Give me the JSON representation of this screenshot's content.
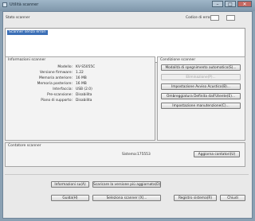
{
  "window": {
    "title": "Utilità scanner"
  },
  "header": {
    "status_label": "Stato scanner",
    "error_code_label": "Codice di errore"
  },
  "status": {
    "selected_item": "Scanner senza errori"
  },
  "info": {
    "title": "Informazioni scanner",
    "rows": [
      {
        "key": "Modello:",
        "value": "KV-S5055C"
      },
      {
        "key": "Versione firmware:",
        "value": "1.22"
      },
      {
        "key": "Memoria anteriore:",
        "value": "16 MB"
      },
      {
        "key": "Memoria posteriore:",
        "value": "16 MB"
      },
      {
        "key": "Interfaccia:",
        "value": "USB (2.0)"
      },
      {
        "key": "Pre-scansione:",
        "value": "Disabilita"
      },
      {
        "key": "Piano di supporto:",
        "value": "Disabilita"
      }
    ]
  },
  "conditions": {
    "title": "Condizione scanner",
    "buttons": [
      {
        "label": "Modalità di spegnimento automatico(S)...",
        "enabled": true
      },
      {
        "label": "Eliminazione(P)...",
        "enabled": false
      },
      {
        "label": "Impostazione Avviso Acustico(B)...",
        "enabled": true
      },
      {
        "label": "Ombreggiatura Definita dall'Utente(E)...",
        "enabled": true
      },
      {
        "label": "Impostazione manutenzione(C)...",
        "enabled": true
      }
    ]
  },
  "counter": {
    "title": "Contatore scanner",
    "system_label": "Sistema:",
    "system_value": "175553",
    "update_button": "Aggiorna contatori(U)"
  },
  "footer": {
    "info_button": "Informazioni su(A)",
    "download_button": "Scaricare la versione più aggiornata(D)",
    "guide_button": "Guida(H)",
    "select_button": "Seleziona scanner (X)...",
    "log_button": "Registro sistema(R)",
    "close_button": "Chiudi"
  },
  "colors": {
    "selection": "#3b6fb6",
    "window_frame": "#8aa0b3"
  }
}
